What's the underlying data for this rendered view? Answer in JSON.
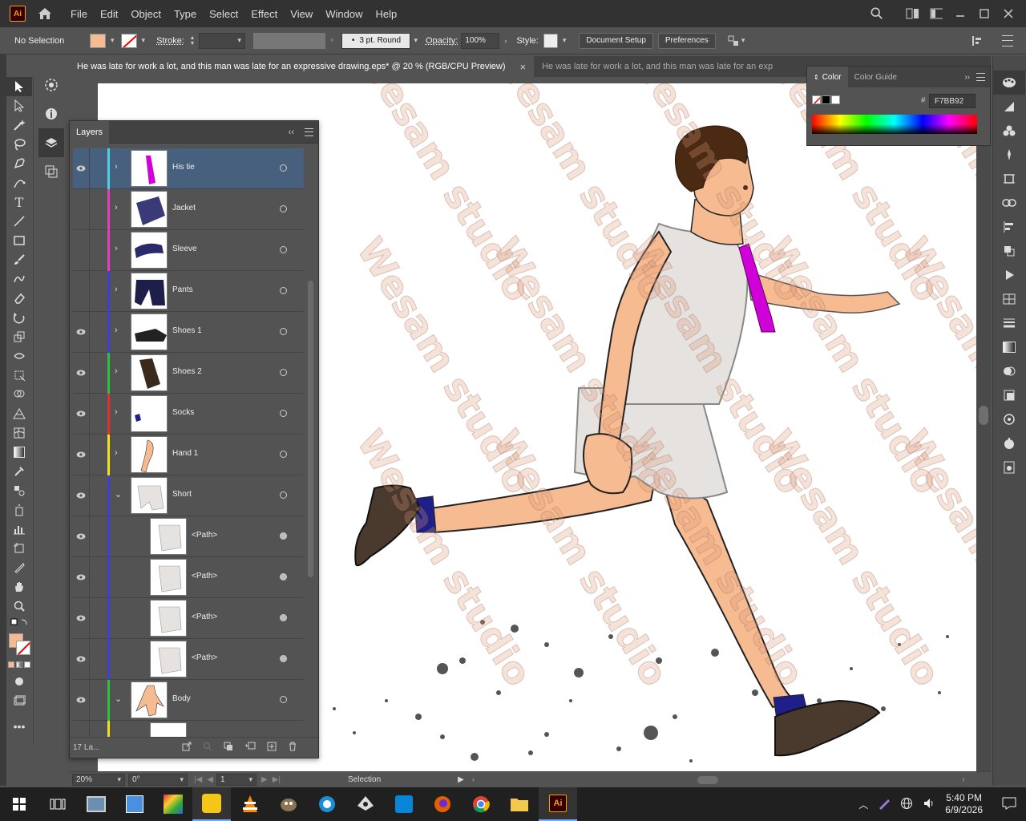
{
  "app": {
    "logo": "Ai"
  },
  "menu": [
    "File",
    "Edit",
    "Object",
    "Type",
    "Select",
    "Effect",
    "View",
    "Window",
    "Help"
  ],
  "control_bar": {
    "selection": "No Selection",
    "stroke_label": "Stroke:",
    "brush": "3 pt. Round",
    "opacity_label": "Opacity:",
    "opacity_value": "100%",
    "style_label": "Style:",
    "document_setup": "Document Setup",
    "preferences": "Preferences"
  },
  "tabs": [
    {
      "label": "He was late for work a lot, and this man was late for an expressive drawing.eps* @ 20 % (RGB/CPU Preview)",
      "close": "×"
    },
    {
      "label": "He was late for work a lot, and this man was late for an exp"
    }
  ],
  "layers_panel": {
    "title": "Layers",
    "count": "17 La...",
    "rows": [
      {
        "name": "His tie",
        "color": "#4fd0e0",
        "visible": true,
        "expand": "›",
        "level": 0,
        "selected": true
      },
      {
        "name": "Jacket",
        "color": "#e040c0",
        "visible": false,
        "expand": "›",
        "level": 0
      },
      {
        "name": "Sleeve",
        "color": "#e040c0",
        "visible": false,
        "expand": "›",
        "level": 0
      },
      {
        "name": "Pants",
        "color": "#4040d0",
        "visible": false,
        "expand": "›",
        "level": 0
      },
      {
        "name": "Shoes 1",
        "color": "#4040d0",
        "visible": true,
        "expand": "›",
        "level": 0
      },
      {
        "name": "Shoes 2",
        "color": "#30c040",
        "visible": true,
        "expand": "›",
        "level": 0
      },
      {
        "name": "Socks",
        "color": "#e03030",
        "visible": true,
        "expand": "›",
        "level": 0
      },
      {
        "name": "Hand 1",
        "color": "#f0e020",
        "visible": true,
        "expand": "›",
        "level": 0
      },
      {
        "name": "Short",
        "color": "#4040d0",
        "visible": true,
        "expand": "⌄",
        "level": 0
      },
      {
        "name": "<Path>",
        "color": "#4040d0",
        "visible": true,
        "expand": "",
        "level": 1
      },
      {
        "name": "<Path>",
        "color": "#4040d0",
        "visible": true,
        "expand": "",
        "level": 1
      },
      {
        "name": "<Path>",
        "color": "#4040d0",
        "visible": true,
        "expand": "",
        "level": 1
      },
      {
        "name": "<Path>",
        "color": "#4040d0",
        "visible": true,
        "expand": "",
        "level": 1
      },
      {
        "name": "Body",
        "color": "#30c040",
        "visible": true,
        "expand": "⌄",
        "level": 0
      },
      {
        "name": "",
        "color": "#f0e020",
        "visible": false,
        "expand": "",
        "level": 1
      }
    ]
  },
  "color_panel": {
    "tab_color": "Color",
    "tab_guide": "Color Guide",
    "hex_label": "#",
    "hex_value": "F7BB92",
    "fill": "#F7BB92"
  },
  "status_bar": {
    "zoom": "20%",
    "rotation": "0°",
    "artboard": "1",
    "tool": "Selection"
  },
  "watermark": "Wesam studio",
  "taskbar": {
    "time": "5:40 PM",
    "date": "6/9/2026"
  }
}
